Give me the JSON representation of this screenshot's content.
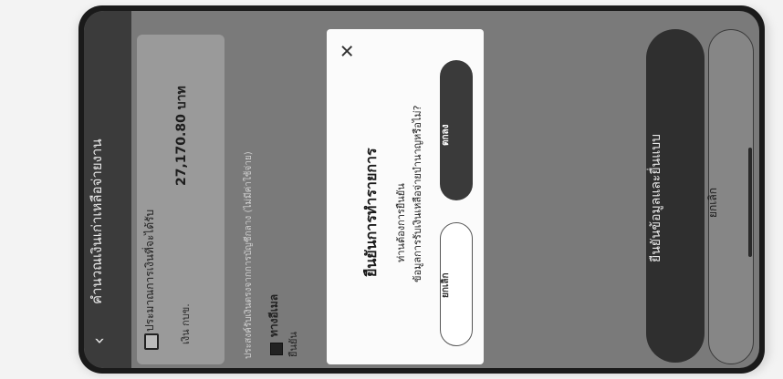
{
  "header": {
    "title": "คำนวณเงินเก่าเหลือจ่ายงาน",
    "back_icon": "chevron-left-icon"
  },
  "card": {
    "plan_label": "ประมาณการเงินที่จะได้รับ",
    "amount_label": "เงิน กบข.",
    "amount_value": "27,170.80 บาท"
  },
  "note": "ประสงค์รับเงินตรงจากการบัญชีกลาง (ไม่มีค่าใช้จ่าย)",
  "wallet_option": "ทางอีเมล",
  "edit_label": "ยืนยัน",
  "dialog": {
    "title": "ยืนยันการทำรายการ",
    "line1": "ท่านต้องการยืนยัน",
    "line2": "ข้อมูลการรับเงินเหลือจ่ายบำนาญหรือไม่?",
    "ok_label": "ตกลง",
    "cancel_label": "ยกเลิก"
  },
  "actions": {
    "confirm_label": "ยืนยันข้อมูลและยื่นแบบ",
    "cancel_label": "ยกเลิก"
  },
  "colors": {
    "overlay": "#7a7a7a",
    "primary": "#2f2f2f",
    "dialog_bg": "#fbfbfb"
  }
}
